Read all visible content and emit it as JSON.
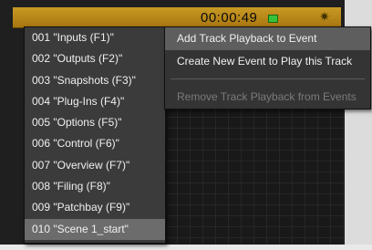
{
  "app": {
    "timecode": "00:00:49",
    "indicator_icon": "green-status-icon",
    "settings_icon": "gear-icon"
  },
  "event_list": {
    "items": [
      {
        "label": "001 \"Inputs (F1)\""
      },
      {
        "label": "002 \"Outputs (F2)\""
      },
      {
        "label": "003 \"Snapshots (F3)\""
      },
      {
        "label": "004 \"Plug-Ins (F4)\""
      },
      {
        "label": "005 \"Options (F5)\""
      },
      {
        "label": "006 \"Control (F6)\""
      },
      {
        "label": "007 \"Overview (F7)\""
      },
      {
        "label": "008 \"Filing (F8)\""
      },
      {
        "label": "009 \"Patchbay (F9)\""
      },
      {
        "label": "010 \"Scene 1_start\""
      }
    ],
    "selected_index": 9
  },
  "context_menu": {
    "add_track": "Add Track Playback to Event",
    "create_event": "Create New Event to Play this Track",
    "remove_track": "Remove Track Playback from Events"
  },
  "colors": {
    "strip_accent": "#c99a24",
    "menu_background": "#3b3b3b",
    "highlight": "#6c6c6c"
  }
}
